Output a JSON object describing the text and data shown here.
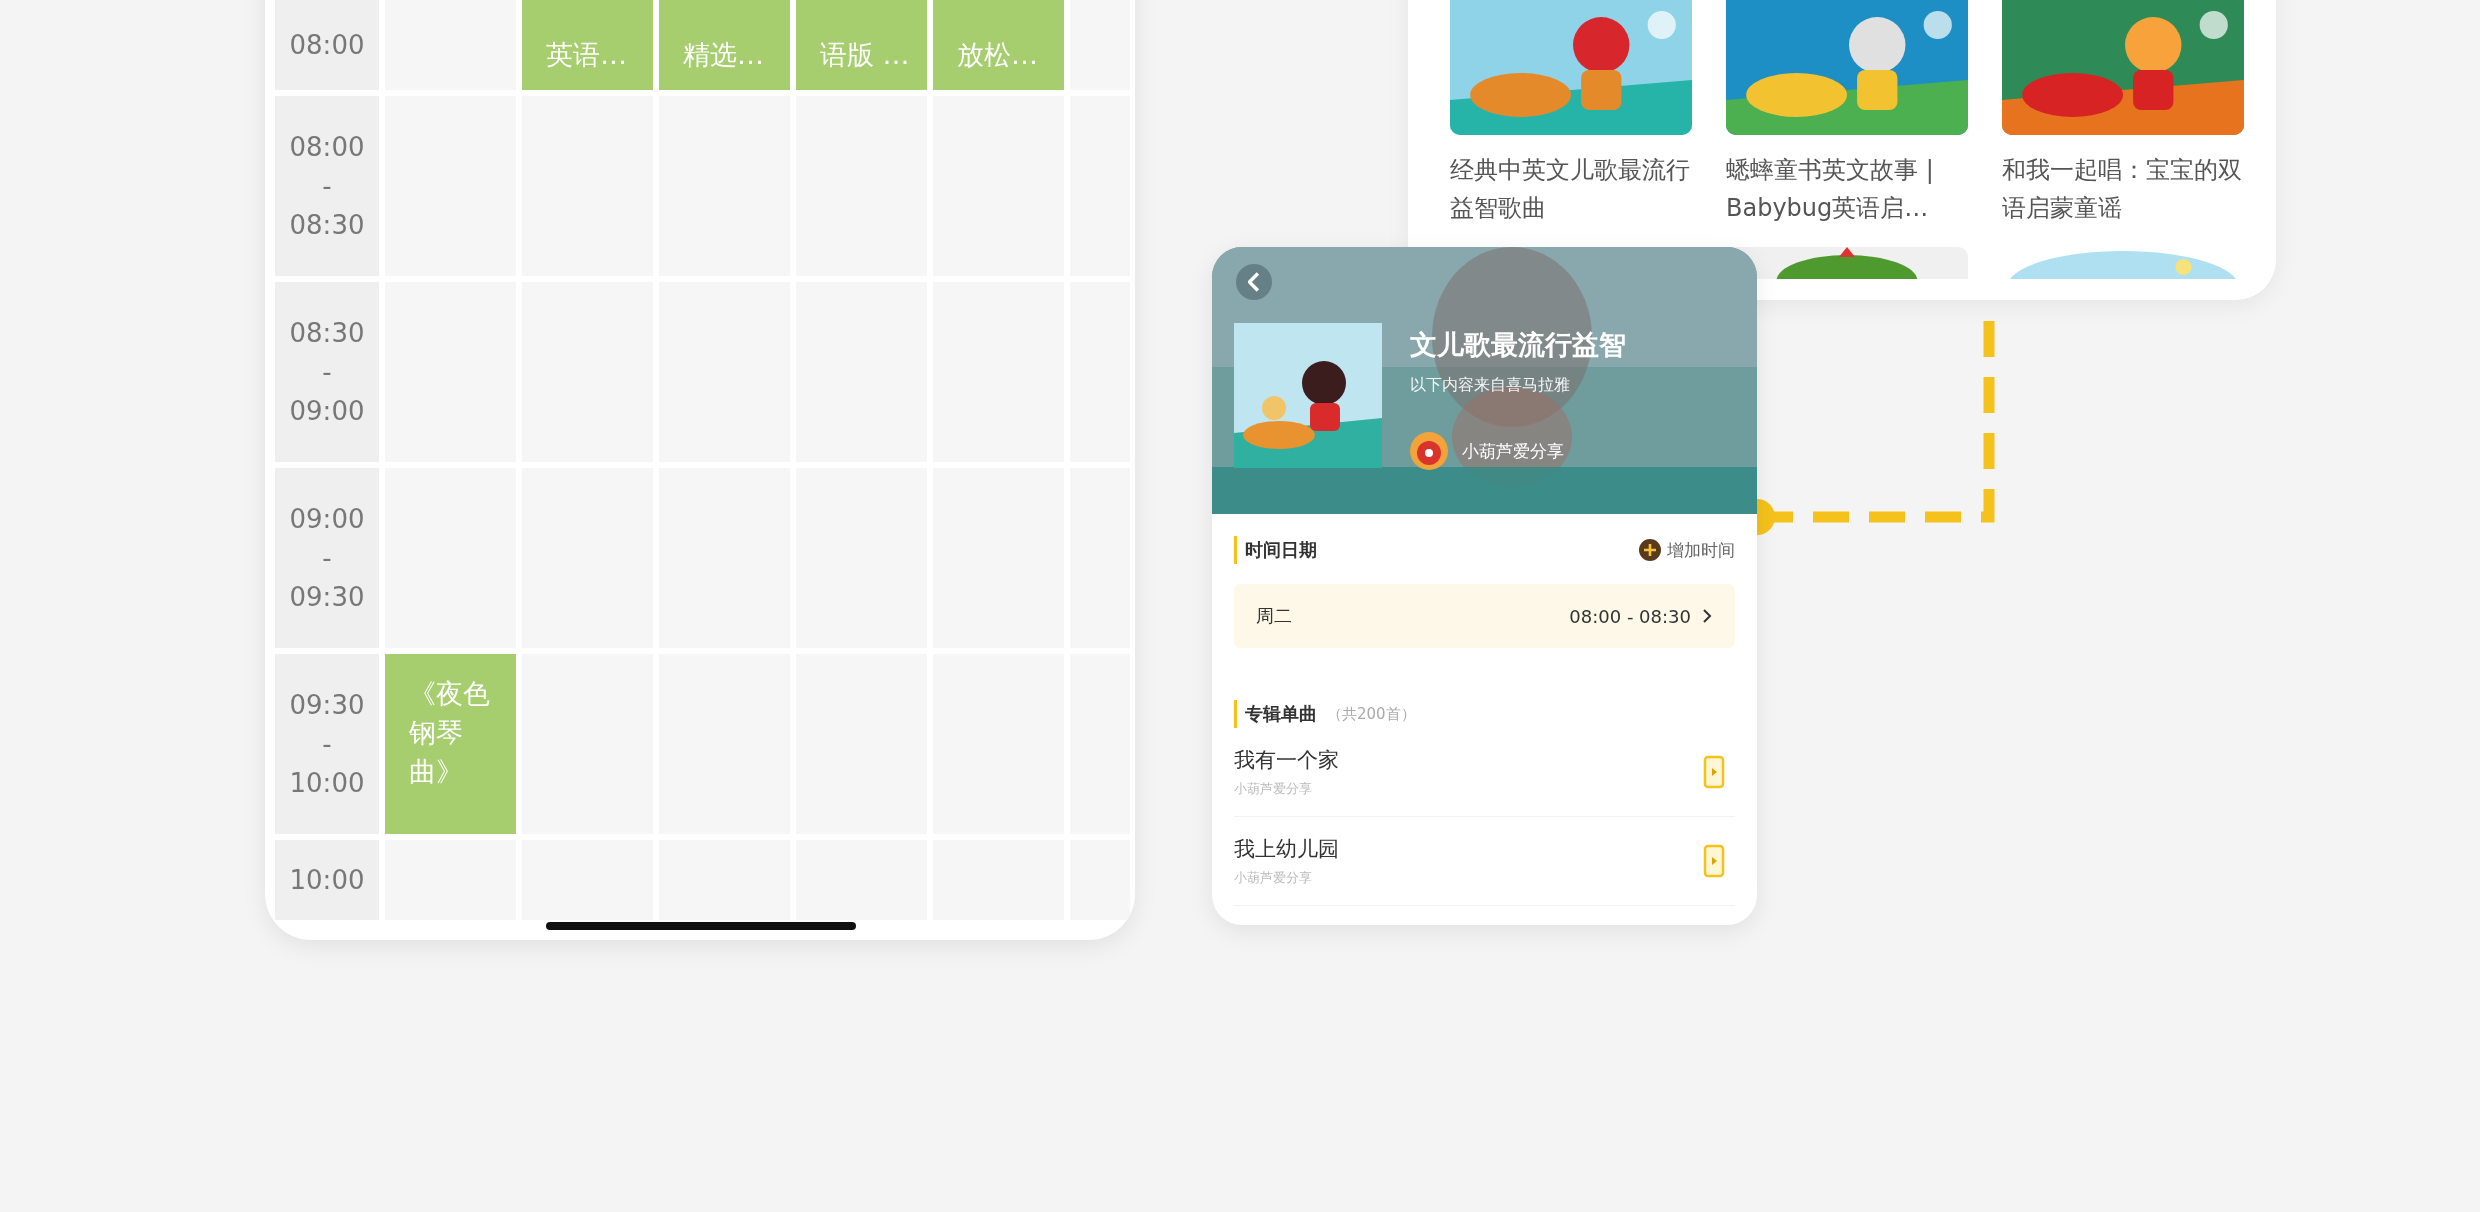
{
  "schedule": {
    "rows": [
      {
        "time": [
          "08:00"
        ],
        "cells": [
          {
            "kind": "empty"
          },
          {
            "kind": "event",
            "text": "英语…"
          },
          {
            "kind": "event",
            "text": "精选…"
          },
          {
            "kind": "event",
            "text": "语版 …"
          },
          {
            "kind": "event",
            "text": "放松…"
          },
          {
            "kind": "empty"
          }
        ]
      },
      {
        "time": [
          "08:00",
          "-",
          "08:30"
        ],
        "cells": [
          {
            "kind": "empty"
          },
          {
            "kind": "empty"
          },
          {
            "kind": "empty"
          },
          {
            "kind": "empty"
          },
          {
            "kind": "empty"
          },
          {
            "kind": "empty"
          }
        ]
      },
      {
        "time": [
          "08:30",
          "-",
          "09:00"
        ],
        "cells": [
          {
            "kind": "empty"
          },
          {
            "kind": "empty"
          },
          {
            "kind": "empty"
          },
          {
            "kind": "empty"
          },
          {
            "kind": "empty"
          },
          {
            "kind": "empty"
          }
        ]
      },
      {
        "time": [
          "09:00",
          "-",
          "09:30"
        ],
        "cells": [
          {
            "kind": "empty"
          },
          {
            "kind": "empty"
          },
          {
            "kind": "empty"
          },
          {
            "kind": "empty"
          },
          {
            "kind": "empty"
          },
          {
            "kind": "empty"
          }
        ]
      },
      {
        "time": [
          "09:30",
          "-",
          "10:00"
        ],
        "cells": [
          {
            "kind": "event",
            "text": "《夜色钢琴曲》"
          },
          {
            "kind": "empty"
          },
          {
            "kind": "empty"
          },
          {
            "kind": "empty"
          },
          {
            "kind": "empty"
          },
          {
            "kind": "empty"
          }
        ]
      },
      {
        "time": [
          "10:00"
        ],
        "cells": [
          {
            "kind": "empty"
          },
          {
            "kind": "empty"
          },
          {
            "kind": "empty"
          },
          {
            "kind": "empty"
          },
          {
            "kind": "empty"
          },
          {
            "kind": "empty"
          }
        ]
      }
    ]
  },
  "albums": [
    {
      "title": "经典中英文儿歌最流行益智歌曲"
    },
    {
      "title": "蟋蟀童书英文故事 | Babybug英语启…"
    },
    {
      "title": "和我一起唱：宝宝的双语启蒙童谣"
    }
  ],
  "album_detail": {
    "title": "文儿歌最流行益智",
    "subtitle": "以下内容来自喜马拉雅",
    "author": "小葫芦爱分享",
    "time_section": {
      "label": "时间日期",
      "add_label": "增加时间",
      "day": "周二",
      "time_range": "08:00 - 08:30"
    },
    "tracks_section": {
      "label": "专辑单曲",
      "count": "（共200首）"
    },
    "tracks": [
      {
        "title": "我有一个家",
        "author": "小葫芦爱分享"
      },
      {
        "title": "我上幼儿园",
        "author": "小葫芦爱分享"
      }
    ]
  }
}
